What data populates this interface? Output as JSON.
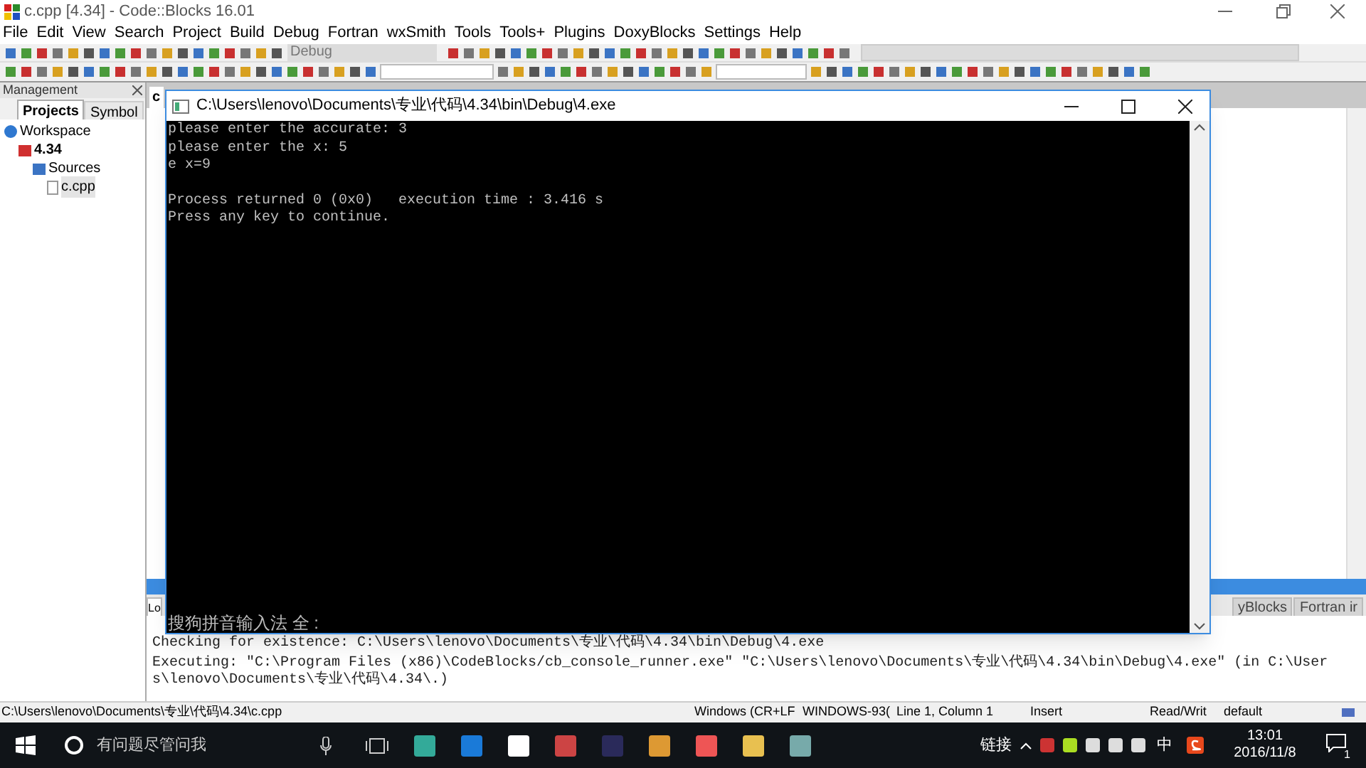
{
  "window": {
    "title": "c.cpp [4.34] - Code::Blocks 16.01"
  },
  "menu": [
    "File",
    "Edit",
    "View",
    "Search",
    "Project",
    "Build",
    "Debug",
    "Fortran",
    "wxSmith",
    "Tools",
    "Tools+",
    "Plugins",
    "DoxyBlocks",
    "Settings",
    "Help"
  ],
  "toolbar": {
    "build_target": "Debug"
  },
  "management": {
    "title": "Management",
    "tabs": [
      {
        "label": "Projects",
        "selected": true
      },
      {
        "label": "Symbol",
        "selected": false
      }
    ],
    "tree": [
      {
        "label": "Workspace",
        "kind": "workspace",
        "selected": false,
        "children": [
          {
            "label": "4.34",
            "kind": "project",
            "selected": false,
            "children": [
              {
                "label": "Sources",
                "kind": "folder",
                "selected": false,
                "children": [
                  {
                    "label": "c.cpp",
                    "kind": "file",
                    "selected": true
                  }
                ]
              }
            ]
          }
        ]
      }
    ]
  },
  "editor": {
    "tabs": [
      {
        "label": "c",
        "selected": true
      }
    ]
  },
  "console": {
    "title": "C:\\Users\\lenovo\\Documents\\专业\\代码\\4.34\\bin\\Debug\\4.exe",
    "output": [
      "please enter the accurate: 3",
      "please enter the x: 5",
      "e x=9"
    ],
    "footer": [
      "Process returned 0 (0x0)   execution time : 3.416 s",
      "Press any key to continue."
    ],
    "ime": "搜狗拼音输入法 全 :"
  },
  "logs": {
    "tabs": [
      {
        "label": "Lo",
        "selected": true
      },
      {
        "label": "yBlocks",
        "selected": false
      },
      {
        "label": "Fortran ir",
        "selected": false
      }
    ],
    "lines": [
      "Checking for existence: C:\\Users\\lenovo\\Documents\\专业\\代码\\4.34\\bin\\Debug\\4.exe",
      "Executing: \"C:\\Program Files (x86)\\CodeBlocks/cb_console_runner.exe\" \"C:\\Users\\lenovo\\Documents\\专业\\代码\\4.34\\bin\\Debug\\4.exe\"  (in C:\\Users\\lenovo\\Documents\\专业\\代码\\4.34\\.)"
    ]
  },
  "status_bar": [
    "C:\\Users\\lenovo\\Documents\\专业\\代码\\4.34\\c.cpp",
    "Windows (CR+LF",
    "WINDOWS-93(",
    "Line 1, Column 1",
    "Insert",
    "Read/Writ",
    "default"
  ],
  "taskbar": {
    "search_placeholder": "有问题尽管问我",
    "tray_label": "链接",
    "ime_mode": "中",
    "time": "13:01",
    "date": "2016/11/8",
    "notifications": "1"
  }
}
